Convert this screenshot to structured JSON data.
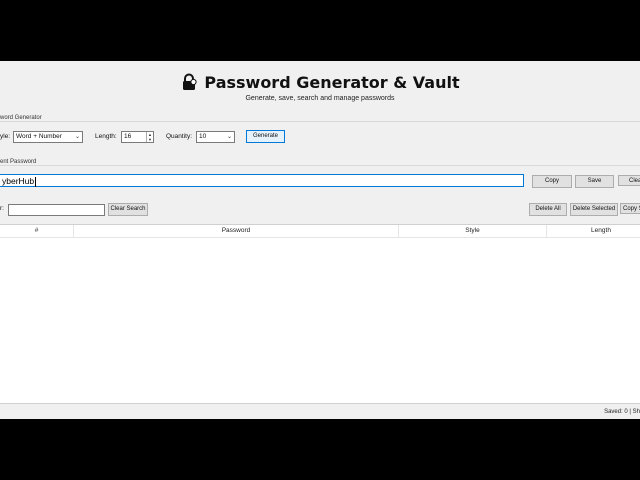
{
  "header": {
    "title": "Password Generator & Vault",
    "subtitle": "Generate, save, search and manage passwords"
  },
  "generator": {
    "group_label": "word Generator",
    "style_label": "yle:",
    "style_value": "Word + Number",
    "length_label": "Length:",
    "length_value": "16",
    "quantity_label": "Quantity:",
    "quantity_value": "10",
    "generate_label": "Generate"
  },
  "current": {
    "group_label": "ent Password",
    "password_value": "yberHub",
    "copy_label": "Copy",
    "save_label": "Save",
    "clear_label": "Clea"
  },
  "search": {
    "label": "r:",
    "value": "",
    "clear_search_label": "Clear Search",
    "delete_all_label": "Delete All",
    "delete_selected_label": "Delete Selected",
    "copy_selected_label": "Copy S"
  },
  "table": {
    "columns": [
      "#",
      "Password",
      "Style",
      "Length"
    ]
  },
  "status": {
    "text": "Saved: 0 | Sh"
  },
  "icons": {
    "title_icon": "lock-icon"
  }
}
